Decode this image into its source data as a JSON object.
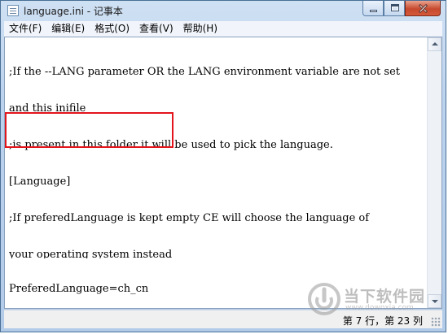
{
  "window": {
    "title": "language.ini - 记事本"
  },
  "menu": {
    "items": [
      {
        "label": "文件(F)"
      },
      {
        "label": "编辑(E)"
      },
      {
        "label": "格式(O)"
      },
      {
        "label": "查看(V)"
      },
      {
        "label": "帮助(H)"
      }
    ]
  },
  "editor": {
    "lines": [
      ";If the --LANG parameter OR the LANG environment variable are not set",
      "and this inifile",
      ";is present in this folder it will be used to pick the language.",
      "[Language]",
      ";If preferedLanguage is kept empty CE will choose the language of",
      "your operating system instead",
      "PreferedLanguage=ch_cn"
    ],
    "highlight_color": "#e3141c"
  },
  "status": {
    "position": "第 7 行，第 23 列"
  },
  "watermark": {
    "name": "当下软件园",
    "url": "www.downxia.com"
  },
  "icons": [
    "notepad-icon",
    "minimize-icon",
    "maximize-icon",
    "close-icon",
    "scroll-up-arrow-icon",
    "scroll-down-arrow-icon",
    "resize-grip-icon",
    "watermark-logo-icon"
  ]
}
